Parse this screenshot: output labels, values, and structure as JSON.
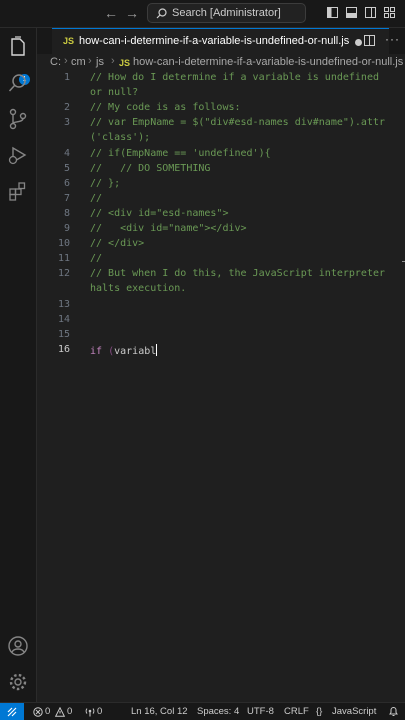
{
  "titlebar": {
    "search_placeholder": "Search [Administrator]"
  },
  "activity_badge": "1",
  "tab": {
    "language": "JS",
    "title": "how-can-i-determine-if-a-variable-is-undefined-or-null.js"
  },
  "breadcrumb": {
    "items": [
      "C:",
      "cm",
      "js"
    ],
    "file_language": "JS",
    "file": "how-can-i-determine-if-a-variable-is-undefined-or-null.js"
  },
  "editor": {
    "lines": [
      {
        "num": "1",
        "segments": [
          {
            "text": "// How do I determine if a variable is undefined",
            "kind": "comment"
          }
        ]
      },
      {
        "num": "",
        "segments": [
          {
            "text": "or null?",
            "kind": "comment"
          }
        ]
      },
      {
        "num": "2",
        "segments": [
          {
            "text": "// My code is as follows:",
            "kind": "comment"
          }
        ]
      },
      {
        "num": "3",
        "segments": [
          {
            "text": "// var EmpName = $(\"div#esd-names div#name\").attr",
            "kind": "comment"
          }
        ]
      },
      {
        "num": "",
        "segments": [
          {
            "text": "('class');",
            "kind": "comment"
          }
        ]
      },
      {
        "num": "4",
        "segments": [
          {
            "text": "// if(EmpName == 'undefined'){",
            "kind": "comment"
          }
        ]
      },
      {
        "num": "5",
        "segments": [
          {
            "text": "//   // DO SOMETHING",
            "kind": "comment"
          }
        ]
      },
      {
        "num": "6",
        "segments": [
          {
            "text": "// };",
            "kind": "comment"
          }
        ]
      },
      {
        "num": "7",
        "segments": [
          {
            "text": "//",
            "kind": "comment"
          }
        ]
      },
      {
        "num": "8",
        "segments": [
          {
            "text": "// <div id=\"esd-names\">",
            "kind": "comment"
          }
        ]
      },
      {
        "num": "9",
        "segments": [
          {
            "text": "//   <div id=\"name\"></div>",
            "kind": "comment"
          }
        ]
      },
      {
        "num": "10",
        "segments": [
          {
            "text": "// </div>",
            "kind": "comment"
          }
        ]
      },
      {
        "num": "11",
        "segments": [
          {
            "text": "//",
            "kind": "comment"
          }
        ]
      },
      {
        "num": "12",
        "segments": [
          {
            "text": "// But when I do this, the JavaScript interpreter",
            "kind": "comment"
          }
        ]
      },
      {
        "num": "",
        "segments": [
          {
            "text": "halts execution.",
            "kind": "comment"
          }
        ]
      },
      {
        "num": "13",
        "segments": []
      },
      {
        "num": "14",
        "segments": []
      },
      {
        "num": "15",
        "segments": []
      },
      {
        "num": "16",
        "active": true,
        "segments": [
          {
            "text": "if",
            "kind": "keyword"
          },
          {
            "text": " ",
            "kind": "plain"
          },
          {
            "text": "(",
            "kind": "punc"
          },
          {
            "text": "variabl",
            "kind": "plain"
          }
        ]
      }
    ]
  },
  "status": {
    "errors": "0",
    "warnings": "0",
    "ports": "0",
    "position": "Ln 16, Col 12",
    "spaces": "Spaces: 4",
    "encoding": "UTF-8",
    "eol": "CRLF",
    "language": "JavaScript"
  }
}
